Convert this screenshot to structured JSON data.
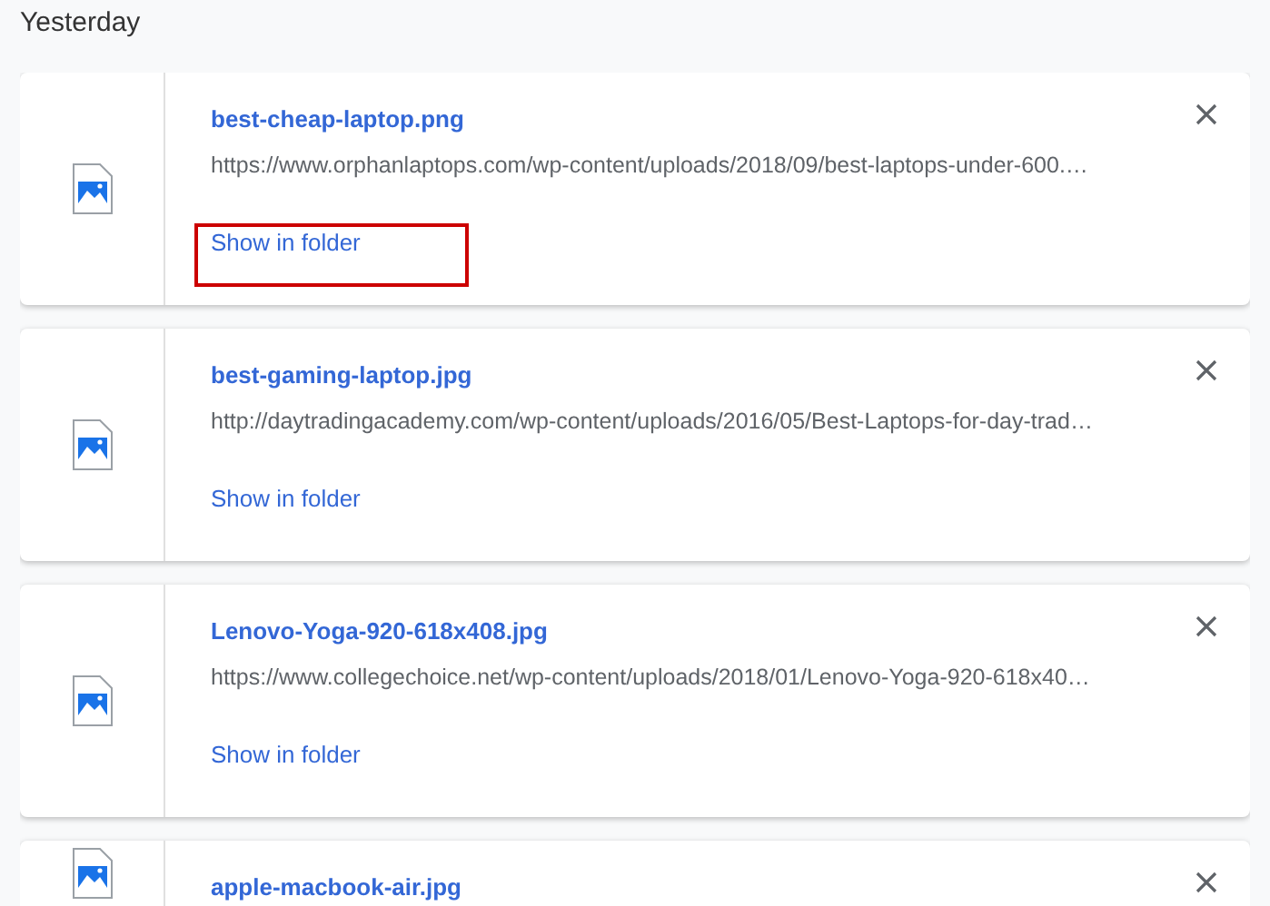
{
  "section_title": "Yesterday",
  "downloads": [
    {
      "filename": "best-cheap-laptop.png",
      "url": "https://www.orphanlaptops.com/wp-content/uploads/2018/09/best-laptops-under-600.…",
      "action": "Show in folder",
      "highlighted": true
    },
    {
      "filename": "best-gaming-laptop.jpg",
      "url": "http://daytradingacademy.com/wp-content/uploads/2016/05/Best-Laptops-for-day-trad…",
      "action": "Show in folder",
      "highlighted": false
    },
    {
      "filename": "Lenovo-Yoga-920-618x408.jpg",
      "url": "https://www.collegechoice.net/wp-content/uploads/2018/01/Lenovo-Yoga-920-618x40…",
      "action": "Show in folder",
      "highlighted": false
    },
    {
      "filename": "apple-macbook-air.jpg"
    }
  ]
}
